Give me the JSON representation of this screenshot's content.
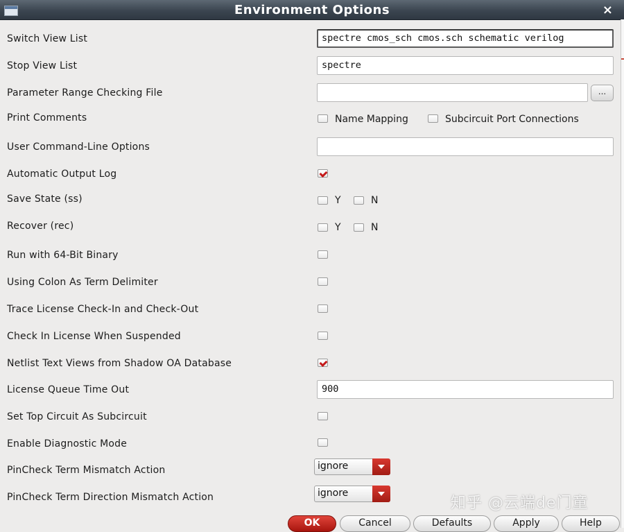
{
  "window": {
    "title": "Environment Options",
    "close_symbol": "×"
  },
  "icons": {
    "menu": "window-menu-icon",
    "close": "close-icon",
    "check": "checkmark-icon",
    "dropdown": "chevron-down-icon"
  },
  "colors": {
    "titlebar": "#3b4550",
    "accent_red": "#c41a1a",
    "ok_button": "#c0231a"
  },
  "options": {
    "switch_view_list": {
      "label": "Switch View List",
      "value": "spectre cmos_sch cmos.sch schematic verilog"
    },
    "stop_view_list": {
      "label": "Stop View List",
      "value": "spectre"
    },
    "param_range_file": {
      "label": "Parameter Range Checking File",
      "value": "",
      "browse_label": "..."
    },
    "print_comments": {
      "label": "Print Comments",
      "name_mapping": "Name Mapping",
      "subckt_ports": "Subcircuit Port Connections"
    },
    "user_cmdline": {
      "label": "User Command-Line Options",
      "value": ""
    },
    "auto_output_log": {
      "label": "Automatic Output Log",
      "checked": true
    },
    "save_state": {
      "label": "Save State (ss)",
      "y": "Y",
      "n": "N"
    },
    "recover": {
      "label": "Recover (rec)",
      "y": "Y",
      "n": "N"
    },
    "run_64bit": {
      "label": "Run with 64-Bit Binary",
      "checked": false
    },
    "colon_delimiter": {
      "label": "Using Colon As Term Delimiter",
      "checked": false
    },
    "trace_license": {
      "label": "Trace License Check-In and Check-Out",
      "checked": false
    },
    "checkin_suspended": {
      "label": "Check In License When Suspended",
      "checked": false
    },
    "netlist_shadow_oa": {
      "label": "Netlist Text Views from Shadow OA Database",
      "checked": true
    },
    "license_queue": {
      "label": "License Queue Time Out",
      "value": "900"
    },
    "top_as_subckt": {
      "label": "Set Top Circuit As Subcircuit",
      "checked": false
    },
    "diagnostic_mode": {
      "label": "Enable Diagnostic Mode",
      "checked": false
    },
    "pincheck_mismatch": {
      "label": "PinCheck Term Mismatch Action",
      "value": "ignore"
    },
    "pincheck_direction": {
      "label": "PinCheck Term Direction Mismatch Action",
      "value": "ignore"
    }
  },
  "buttons": {
    "ok": "OK",
    "cancel": "Cancel",
    "defaults": "Defaults",
    "apply": "Apply",
    "help": "Help"
  },
  "watermark": "知乎 @云端de门童"
}
